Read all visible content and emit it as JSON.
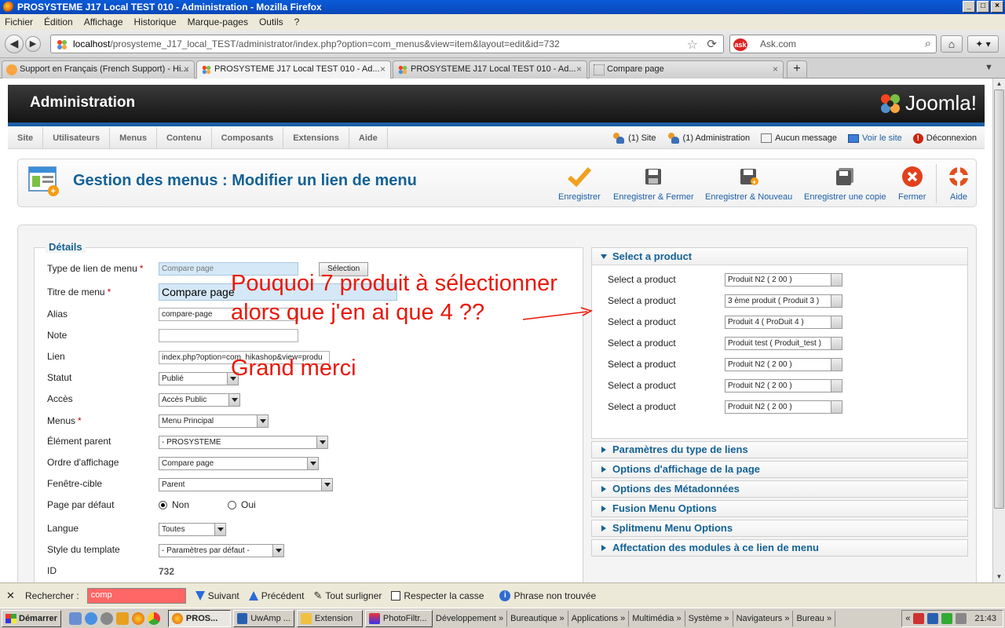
{
  "window": {
    "title": "PROSYSTEME J17 Local TEST 010 - Administration - Mozilla Firefox"
  },
  "menubar": [
    "Fichier",
    "Édition",
    "Affichage",
    "Historique",
    "Marque-pages",
    "Outils",
    "?"
  ],
  "navbar": {
    "url_host": "localhost",
    "url_path": "/prosysteme_J17_local_TEST/administrator/index.php?option=com_menus&view=item&layout=edit&id=732",
    "search_placeholder": "Ask.com"
  },
  "tabs": [
    {
      "label": "Support en Français (French Support) - Hi..."
    },
    {
      "label": "PROSYSTEME J17 Local TEST 010 - Ad..."
    },
    {
      "label": "PROSYSTEME J17 Local TEST 010 - Ad..."
    },
    {
      "label": "Compare page"
    }
  ],
  "admin": {
    "title": "Administration",
    "logo_text": "Joomla!"
  },
  "submenu": [
    "Site",
    "Utilisateurs",
    "Menus",
    "Contenu",
    "Composants",
    "Extensions",
    "Aide"
  ],
  "status": {
    "site": "(1) Site",
    "admin": "(1) Administration",
    "messages": "Aucun message",
    "view_site": "Voir le site",
    "logout": "Déconnexion"
  },
  "toolbar": {
    "page_title": "Gestion des menus : Modifier un lien de menu",
    "buttons": [
      "Enregistrer",
      "Enregistrer & Fermer",
      "Enregistrer & Nouveau",
      "Enregistrer une copie",
      "Fermer",
      "Aide"
    ]
  },
  "details": {
    "legend": "Détails",
    "type_label": "Type de lien de menu",
    "type_value": "Compare page",
    "type_button": "Sélection",
    "title_label": "Titre de menu",
    "title_value": "Compare page",
    "alias_label": "Alias",
    "alias_value": "compare-page",
    "note_label": "Note",
    "note_value": "",
    "link_label": "Lien",
    "link_value": "index.php?option=com_hikashop&view=produ",
    "status_label": "Statut",
    "status_value": "Publié",
    "access_label": "Accès",
    "access_value": "Accès Public",
    "menus_label": "Menus",
    "menus_value": "Menu Principal",
    "parent_label": "Élément parent",
    "parent_value": "- PROSYSTEME",
    "order_label": "Ordre d'affichage",
    "order_value": "Compare page",
    "target_label": "Fenêtre-cible",
    "target_value": "Parent",
    "default_label": "Page par défaut",
    "default_no": "Non",
    "default_yes": "Oui",
    "lang_label": "Langue",
    "lang_value": "Toutes",
    "style_label": "Style du template",
    "style_value": "- Paramètres par défaut -",
    "id_label": "ID",
    "id_value": "732"
  },
  "product_panel": {
    "title": "Select a product",
    "rows": [
      {
        "label": "Select a product",
        "value": "Produit N2 ( 2 00 )"
      },
      {
        "label": "Select a product",
        "value": "3 ème produit ( Produit 3 )"
      },
      {
        "label": "Select a product",
        "value": "Produit 4 ( ProDuit 4 )"
      },
      {
        "label": "Select a product",
        "value": "Produit test ( Produit_test )"
      },
      {
        "label": "Select a product",
        "value": "Produit N2 ( 2 00 )"
      },
      {
        "label": "Select a product",
        "value": "Produit N2 ( 2 00 )"
      },
      {
        "label": "Select a product",
        "value": "Produit N2 ( 2 00 )"
      }
    ]
  },
  "collapsed_panels": [
    "Paramètres du type de liens",
    "Options d'affichage de la page",
    "Options des Métadonnées",
    "Fusion Menu Options",
    "Splitmenu Menu Options",
    "Affectation des modules à ce lien de menu"
  ],
  "annotations": {
    "line1": "Pouquoi 7 produit à sélectionner",
    "line2": "alors que j'en ai que 4 ??",
    "line3": "Grand merci",
    "color": "#e8190a"
  },
  "findbar": {
    "label": "Rechercher :",
    "query": "comp",
    "next": "Suivant",
    "prev": "Précédent",
    "highlight": "Tout surligner",
    "match_case": "Respecter la casse",
    "status": "Phrase non trouvée"
  },
  "taskbar": {
    "start": "Démarrer",
    "tasks": [
      "PROS...",
      "UwAmp ...",
      "Extension",
      "PhotoFiltr..."
    ],
    "toolbars": [
      "Développement",
      "Bureautique",
      "Applications",
      "Multimédia",
      "Système",
      "Navigateurs",
      "Bureau"
    ],
    "clock": "21:43"
  }
}
